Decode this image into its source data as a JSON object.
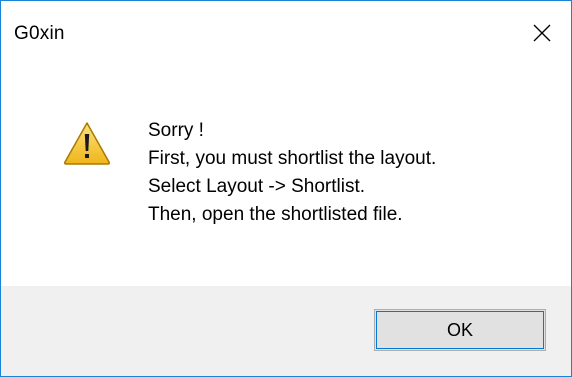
{
  "window": {
    "title": "G0xin",
    "close_icon": "close-icon"
  },
  "message": {
    "icon": "warning-icon",
    "lines": [
      "Sorry !",
      "First, you must shortlist the layout.",
      "Select Layout -> Shortlist.",
      "Then, open the shortlisted file."
    ]
  },
  "buttons": {
    "ok_label": "OK"
  },
  "colors": {
    "border": "#1883d7",
    "footer_bg": "#f0f0f0",
    "button_bg": "#e1e1e1",
    "button_focus": "#0078d7",
    "warning_fill": "#f4c430"
  }
}
